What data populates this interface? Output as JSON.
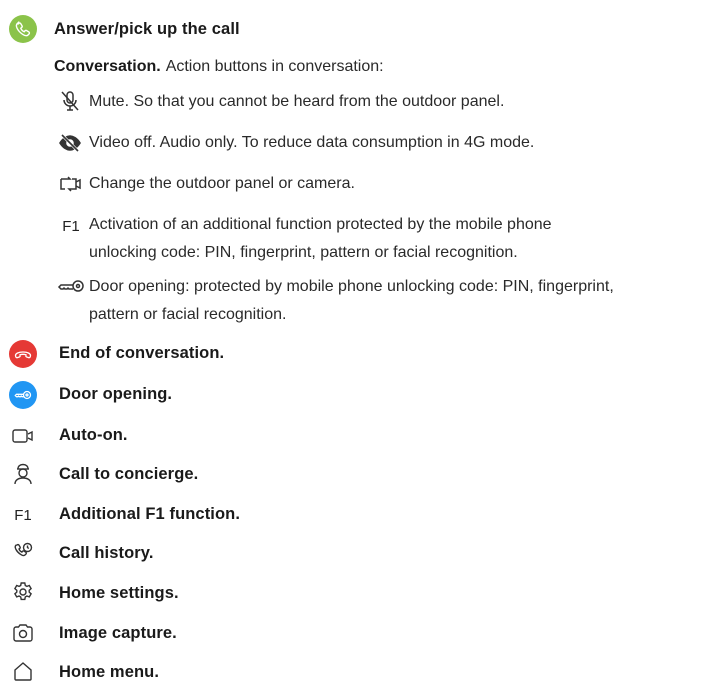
{
  "answer": {
    "label": "Answer/pick up the call",
    "icon": "phone-icon",
    "color": "#8bc34a"
  },
  "conversation": {
    "heading": "Conversation.",
    "intro": "Action buttons in conversation:",
    "actions": [
      {
        "icon": "microphone-off-icon",
        "text": "Mute. So that you cannot be heard from the outdoor panel."
      },
      {
        "icon": "eye-off-icon",
        "text": "Video off. Audio only. To reduce data consumption in 4G mode."
      },
      {
        "icon": "switch-camera-icon",
        "text": "Change the outdoor panel or camera."
      },
      {
        "icon": "f1-icon",
        "icon_text": "F1",
        "line1": "Activation of an additional function protected by the mobile phone",
        "line2": "unlocking code: PIN, fingerprint, pattern or facial recognition."
      },
      {
        "icon": "key-icon",
        "line1": "Door opening: protected by mobile phone unlocking code: PIN, fingerprint,",
        "line2": "pattern or facial recognition."
      }
    ]
  },
  "items": [
    {
      "icon": "hang-up-icon",
      "label": "End of conversation.",
      "color": "#e53935"
    },
    {
      "icon": "door-key-icon",
      "label": "Door opening.",
      "color": "#2196f3"
    },
    {
      "icon": "video-camera-icon",
      "label": "Auto-on."
    },
    {
      "icon": "concierge-icon",
      "label": "Call to concierge."
    },
    {
      "icon": "f1-icon",
      "icon_text": "F1",
      "label": "Additional F1 function."
    },
    {
      "icon": "call-history-icon",
      "label": "Call history."
    },
    {
      "icon": "gear-icon",
      "label": "Home settings."
    },
    {
      "icon": "camera-icon",
      "label": "Image capture."
    },
    {
      "icon": "home-icon",
      "label": "Home menu."
    }
  ]
}
